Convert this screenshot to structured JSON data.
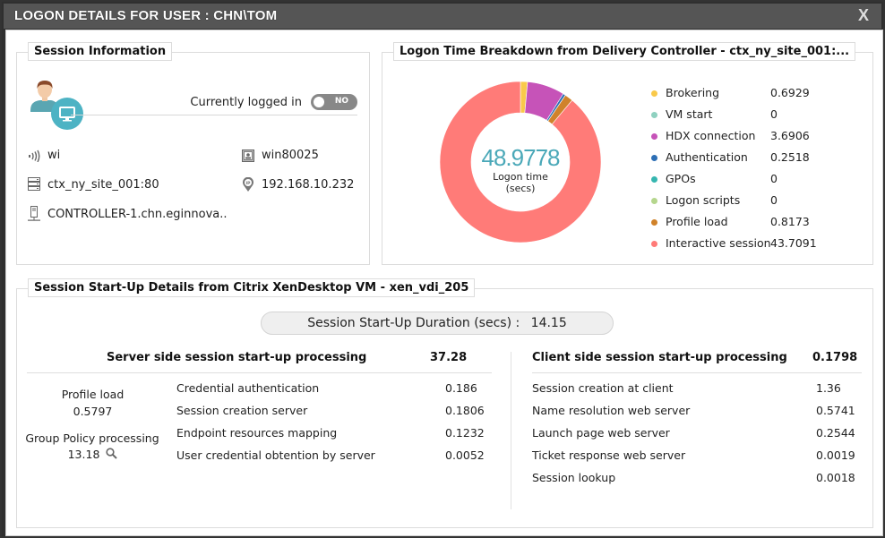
{
  "dialog": {
    "title": "LOGON DETAILS FOR USER : CHN\\TOM",
    "close_label": "X"
  },
  "session_info": {
    "title": "Session Information",
    "logged_in_label": "Currently logged in",
    "logged_in_toggle": "NO",
    "items": {
      "client": "wi",
      "host": "win80025",
      "site": "ctx_ny_site_001:80",
      "ip": "192.168.10.232",
      "controller": "CONTROLLER-1.chn.eginnova.."
    }
  },
  "logon_breakdown": {
    "title": "Logon Time Breakdown from Delivery Controller - ctx_ny_site_001:...",
    "total_value": "48.9778",
    "total_label_line1": "Logon time",
    "total_label_line2": "(secs)"
  },
  "chart_data": {
    "type": "pie",
    "title": "Logon Time Breakdown from Delivery Controller - ctx_ny_site_001:...",
    "center_value": 48.9778,
    "center_label": "Logon time (secs)",
    "legend_position": "right",
    "categories": [
      "Brokering",
      "VM start",
      "HDX connection",
      "Authentication",
      "GPOs",
      "Logon scripts",
      "Profile load",
      "Interactive session"
    ],
    "values": [
      0.6929,
      0,
      3.6906,
      0.2518,
      0,
      0,
      0.8173,
      43.7091
    ],
    "display_values": [
      "0.6929",
      "0",
      "3.6906",
      "0.2518",
      "0",
      "0",
      "0.8173",
      "43.7091"
    ],
    "colors": [
      "#f9c94a",
      "#8fd1c0",
      "#c653b8",
      "#2d6fb5",
      "#36b6b0",
      "#b5d68d",
      "#d0822a",
      "#ff7b78"
    ]
  },
  "startup": {
    "title": "Session Start-Up Details from Citrix XenDesktop VM - xen_vdi_205",
    "duration_label": "Session Start-Up Duration (secs) :",
    "duration_value": "14.15",
    "server": {
      "heading": "Server side session start-up processing",
      "total": "37.28",
      "profile_load_label": "Profile load",
      "profile_load_value": "0.5797",
      "gpo_label": "Group Policy processing",
      "gpo_value": "13.18",
      "rows": [
        {
          "label": "Credential authentication",
          "value": "0.186"
        },
        {
          "label": "Session creation server",
          "value": "0.1806"
        },
        {
          "label": "Endpoint resources mapping",
          "value": "0.1232"
        },
        {
          "label": "User credential obtention by server",
          "value": "0.0052"
        }
      ]
    },
    "client": {
      "heading": "Client side session start-up processing",
      "total": "0.1798",
      "rows": [
        {
          "label": "Session creation at client",
          "value": "1.36"
        },
        {
          "label": "Name resolution web server",
          "value": "0.5741"
        },
        {
          "label": "Launch page web server",
          "value": "0.2544"
        },
        {
          "label": "Ticket response web server",
          "value": "0.0019"
        },
        {
          "label": "Session lookup",
          "value": "0.0018"
        }
      ]
    }
  }
}
